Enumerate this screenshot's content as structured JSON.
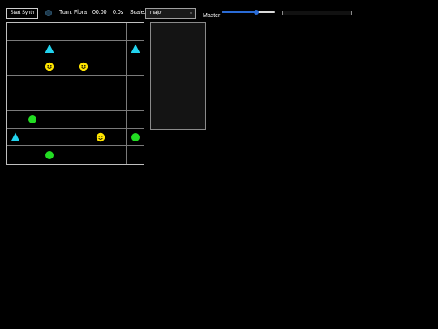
{
  "toolbar": {
    "start_button_label": "Start Synth",
    "status_icon": "status-dot-icon",
    "turn_text": "Turn: Flora",
    "timer_text": "00:00",
    "elapsed_text": "0.0s",
    "scale_label": "Scale:",
    "scale_selected": "major",
    "master_label": "Master:",
    "master_volume_fraction": 0.65,
    "level_meter_fraction": 0
  },
  "colors": {
    "background": "#000000",
    "triangle": "#22d3ee",
    "smiley": "#ffe500",
    "circle": "#22dd22",
    "slider_accent": "#2a6bd6"
  },
  "board": {
    "rows": 8,
    "cols": 8,
    "pieces": [
      {
        "row": 1,
        "col": 2,
        "type": "triangle-icon"
      },
      {
        "row": 1,
        "col": 7,
        "type": "triangle-icon"
      },
      {
        "row": 2,
        "col": 2,
        "type": "smiley-icon"
      },
      {
        "row": 2,
        "col": 4,
        "type": "smiley-icon"
      },
      {
        "row": 5,
        "col": 1,
        "type": "circle-icon"
      },
      {
        "row": 6,
        "col": 0,
        "type": "triangle-icon"
      },
      {
        "row": 6,
        "col": 5,
        "type": "smiley-icon"
      },
      {
        "row": 6,
        "col": 7,
        "type": "circle-icon"
      },
      {
        "row": 7,
        "col": 2,
        "type": "circle-icon"
      }
    ]
  },
  "side_panel": {
    "content": ""
  }
}
